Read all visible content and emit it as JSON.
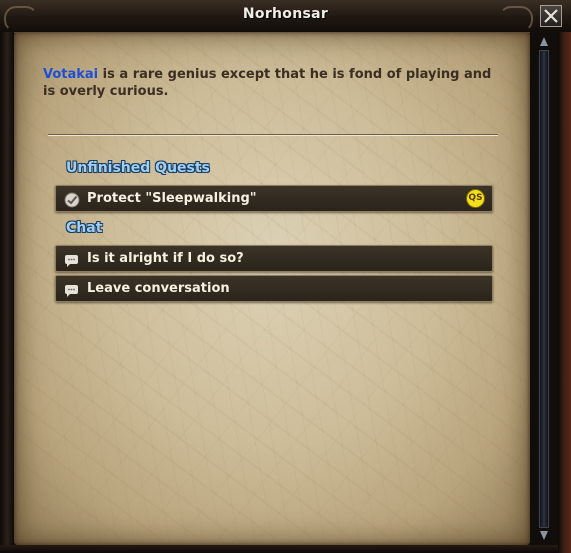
{
  "window": {
    "title": "Norhonsar"
  },
  "dialog": {
    "npc_name": "Votakai",
    "description": " is a rare genius except that he is fond of playing and is overly curious."
  },
  "sections": {
    "quests_label": "Unfinished Quests",
    "chat_label": "Chat"
  },
  "quests": [
    {
      "label": "Protect \"Sleepwalking\"",
      "badge": "QS",
      "icon": "quest-check-icon"
    }
  ],
  "chat_options": [
    {
      "label": "Is it alright if I do so?",
      "icon": "speech-bubble-icon"
    },
    {
      "label": "Leave conversation",
      "icon": "speech-bubble-icon"
    }
  ],
  "colors": {
    "npc_name": "#1f4ed6",
    "section_label": "#9fd0f2",
    "quest_badge": "#f2e01a",
    "option_bg": "#2f2920",
    "parchment": "#cdbd99"
  }
}
